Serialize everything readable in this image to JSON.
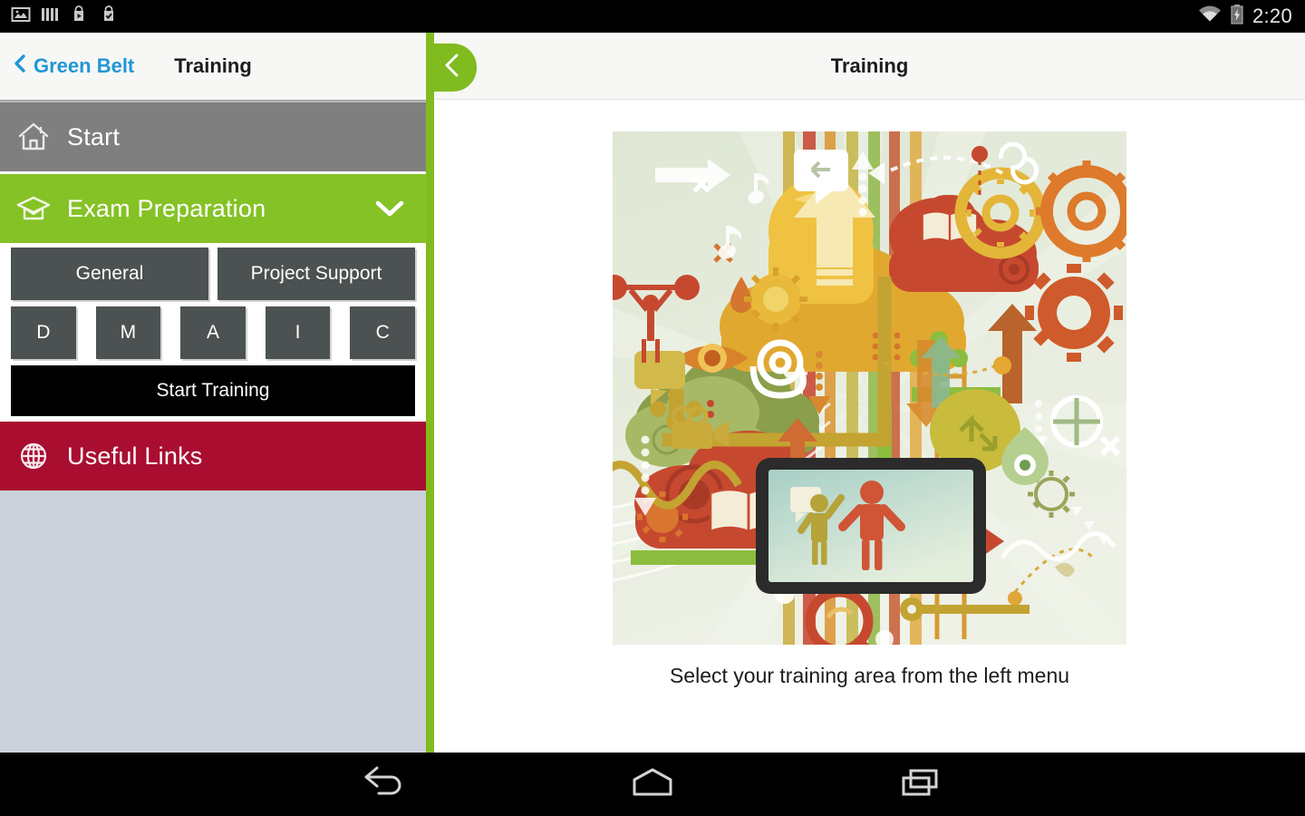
{
  "statusbar": {
    "time": "2:20",
    "left_icons": [
      {
        "name": "photo-notification-icon"
      },
      {
        "name": "bars-notification-icon"
      },
      {
        "name": "play-store-notification-icon"
      },
      {
        "name": "play-store-check-notification-icon"
      }
    ],
    "right_icons": [
      {
        "name": "wifi-icon"
      },
      {
        "name": "battery-charging-icon"
      }
    ]
  },
  "left_panel": {
    "back_label": "Green Belt",
    "title": "Training",
    "menu": [
      {
        "label": "Start",
        "icon": "home-icon",
        "color": "#7f7f7f"
      },
      {
        "label": "Exam Preparation",
        "icon": "graduation-cap-icon",
        "color": "#85c226",
        "chevron": "chevron-down-icon"
      },
      {
        "label": "Useful Links",
        "icon": "globe-icon",
        "color": "#a90e31"
      }
    ],
    "submenu": {
      "category_buttons": [
        {
          "label": "General"
        },
        {
          "label": "Project Support"
        }
      ],
      "phase_buttons": [
        {
          "label": "D"
        },
        {
          "label": "M"
        },
        {
          "label": "A"
        },
        {
          "label": "I"
        },
        {
          "label": "C"
        }
      ],
      "action_button": {
        "label": "Start Training"
      }
    }
  },
  "pull_tab": {
    "icon": "back-chevron-icon"
  },
  "right_panel": {
    "title": "Training",
    "illustration": {
      "name": "training-concept-illustration"
    },
    "caption": "Select your training area from the left menu"
  },
  "navbar": {
    "buttons": [
      {
        "name": "back-button",
        "icon": "back-arrow-icon"
      },
      {
        "name": "home-button",
        "icon": "home-pentagon-icon"
      },
      {
        "name": "recents-button",
        "icon": "recent-apps-icon"
      }
    ]
  },
  "colors": {
    "green": "#85c226",
    "divider_green": "#80bc1f",
    "crimson": "#a90e31",
    "gray": "#7f7f7f",
    "button_gray": "#4c5152",
    "sidebar_bg": "#ccd2da",
    "link_blue": "#2196d6"
  }
}
